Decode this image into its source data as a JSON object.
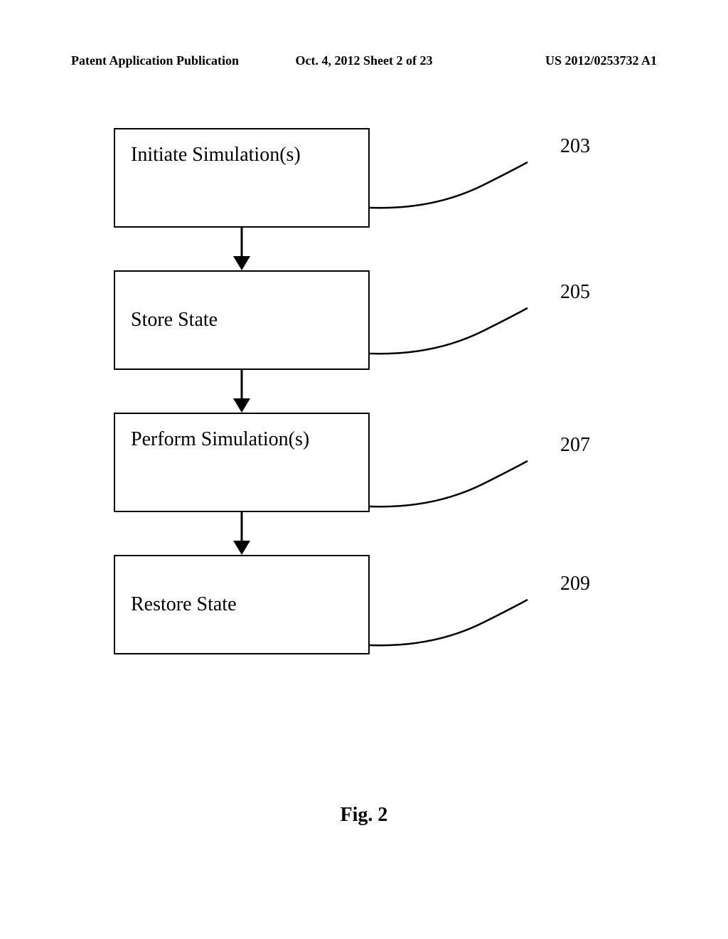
{
  "header": {
    "left": "Patent Application Publication",
    "center": "Oct. 4, 2012   Sheet 2 of 23",
    "right": "US 2012/0253732 A1"
  },
  "flowchart": {
    "boxes": [
      {
        "label": "Initiate Simulation(s)",
        "ref": "203"
      },
      {
        "label": "Store State",
        "ref": "205"
      },
      {
        "label": "Perform Simulation(s)",
        "ref": "207"
      },
      {
        "label": "Restore State",
        "ref": "209"
      }
    ]
  },
  "figure_caption": "Fig. 2"
}
